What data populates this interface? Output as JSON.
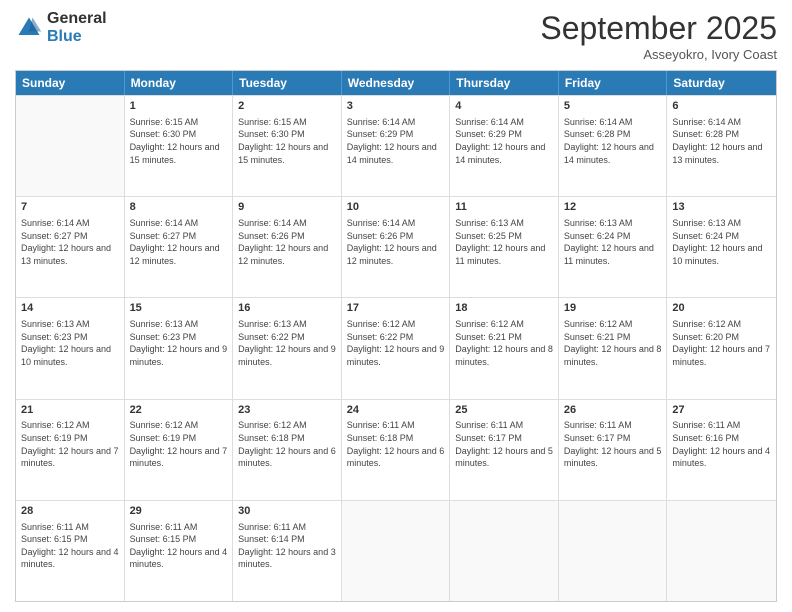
{
  "logo": {
    "general": "General",
    "blue": "Blue"
  },
  "header": {
    "month": "September 2025",
    "location": "Asseyokro, Ivory Coast"
  },
  "days": [
    "Sunday",
    "Monday",
    "Tuesday",
    "Wednesday",
    "Thursday",
    "Friday",
    "Saturday"
  ],
  "weeks": [
    [
      {
        "num": "",
        "sunrise": "",
        "sunset": "",
        "daylight": ""
      },
      {
        "num": "1",
        "sunrise": "Sunrise: 6:15 AM",
        "sunset": "Sunset: 6:30 PM",
        "daylight": "Daylight: 12 hours and 15 minutes."
      },
      {
        "num": "2",
        "sunrise": "Sunrise: 6:15 AM",
        "sunset": "Sunset: 6:30 PM",
        "daylight": "Daylight: 12 hours and 15 minutes."
      },
      {
        "num": "3",
        "sunrise": "Sunrise: 6:14 AM",
        "sunset": "Sunset: 6:29 PM",
        "daylight": "Daylight: 12 hours and 14 minutes."
      },
      {
        "num": "4",
        "sunrise": "Sunrise: 6:14 AM",
        "sunset": "Sunset: 6:29 PM",
        "daylight": "Daylight: 12 hours and 14 minutes."
      },
      {
        "num": "5",
        "sunrise": "Sunrise: 6:14 AM",
        "sunset": "Sunset: 6:28 PM",
        "daylight": "Daylight: 12 hours and 14 minutes."
      },
      {
        "num": "6",
        "sunrise": "Sunrise: 6:14 AM",
        "sunset": "Sunset: 6:28 PM",
        "daylight": "Daylight: 12 hours and 13 minutes."
      }
    ],
    [
      {
        "num": "7",
        "sunrise": "Sunrise: 6:14 AM",
        "sunset": "Sunset: 6:27 PM",
        "daylight": "Daylight: 12 hours and 13 minutes."
      },
      {
        "num": "8",
        "sunrise": "Sunrise: 6:14 AM",
        "sunset": "Sunset: 6:27 PM",
        "daylight": "Daylight: 12 hours and 12 minutes."
      },
      {
        "num": "9",
        "sunrise": "Sunrise: 6:14 AM",
        "sunset": "Sunset: 6:26 PM",
        "daylight": "Daylight: 12 hours and 12 minutes."
      },
      {
        "num": "10",
        "sunrise": "Sunrise: 6:14 AM",
        "sunset": "Sunset: 6:26 PM",
        "daylight": "Daylight: 12 hours and 12 minutes."
      },
      {
        "num": "11",
        "sunrise": "Sunrise: 6:13 AM",
        "sunset": "Sunset: 6:25 PM",
        "daylight": "Daylight: 12 hours and 11 minutes."
      },
      {
        "num": "12",
        "sunrise": "Sunrise: 6:13 AM",
        "sunset": "Sunset: 6:24 PM",
        "daylight": "Daylight: 12 hours and 11 minutes."
      },
      {
        "num": "13",
        "sunrise": "Sunrise: 6:13 AM",
        "sunset": "Sunset: 6:24 PM",
        "daylight": "Daylight: 12 hours and 10 minutes."
      }
    ],
    [
      {
        "num": "14",
        "sunrise": "Sunrise: 6:13 AM",
        "sunset": "Sunset: 6:23 PM",
        "daylight": "Daylight: 12 hours and 10 minutes."
      },
      {
        "num": "15",
        "sunrise": "Sunrise: 6:13 AM",
        "sunset": "Sunset: 6:23 PM",
        "daylight": "Daylight: 12 hours and 9 minutes."
      },
      {
        "num": "16",
        "sunrise": "Sunrise: 6:13 AM",
        "sunset": "Sunset: 6:22 PM",
        "daylight": "Daylight: 12 hours and 9 minutes."
      },
      {
        "num": "17",
        "sunrise": "Sunrise: 6:12 AM",
        "sunset": "Sunset: 6:22 PM",
        "daylight": "Daylight: 12 hours and 9 minutes."
      },
      {
        "num": "18",
        "sunrise": "Sunrise: 6:12 AM",
        "sunset": "Sunset: 6:21 PM",
        "daylight": "Daylight: 12 hours and 8 minutes."
      },
      {
        "num": "19",
        "sunrise": "Sunrise: 6:12 AM",
        "sunset": "Sunset: 6:21 PM",
        "daylight": "Daylight: 12 hours and 8 minutes."
      },
      {
        "num": "20",
        "sunrise": "Sunrise: 6:12 AM",
        "sunset": "Sunset: 6:20 PM",
        "daylight": "Daylight: 12 hours and 7 minutes."
      }
    ],
    [
      {
        "num": "21",
        "sunrise": "Sunrise: 6:12 AM",
        "sunset": "Sunset: 6:19 PM",
        "daylight": "Daylight: 12 hours and 7 minutes."
      },
      {
        "num": "22",
        "sunrise": "Sunrise: 6:12 AM",
        "sunset": "Sunset: 6:19 PM",
        "daylight": "Daylight: 12 hours and 7 minutes."
      },
      {
        "num": "23",
        "sunrise": "Sunrise: 6:12 AM",
        "sunset": "Sunset: 6:18 PM",
        "daylight": "Daylight: 12 hours and 6 minutes."
      },
      {
        "num": "24",
        "sunrise": "Sunrise: 6:11 AM",
        "sunset": "Sunset: 6:18 PM",
        "daylight": "Daylight: 12 hours and 6 minutes."
      },
      {
        "num": "25",
        "sunrise": "Sunrise: 6:11 AM",
        "sunset": "Sunset: 6:17 PM",
        "daylight": "Daylight: 12 hours and 5 minutes."
      },
      {
        "num": "26",
        "sunrise": "Sunrise: 6:11 AM",
        "sunset": "Sunset: 6:17 PM",
        "daylight": "Daylight: 12 hours and 5 minutes."
      },
      {
        "num": "27",
        "sunrise": "Sunrise: 6:11 AM",
        "sunset": "Sunset: 6:16 PM",
        "daylight": "Daylight: 12 hours and 4 minutes."
      }
    ],
    [
      {
        "num": "28",
        "sunrise": "Sunrise: 6:11 AM",
        "sunset": "Sunset: 6:15 PM",
        "daylight": "Daylight: 12 hours and 4 minutes."
      },
      {
        "num": "29",
        "sunrise": "Sunrise: 6:11 AM",
        "sunset": "Sunset: 6:15 PM",
        "daylight": "Daylight: 12 hours and 4 minutes."
      },
      {
        "num": "30",
        "sunrise": "Sunrise: 6:11 AM",
        "sunset": "Sunset: 6:14 PM",
        "daylight": "Daylight: 12 hours and 3 minutes."
      },
      {
        "num": "",
        "sunrise": "",
        "sunset": "",
        "daylight": ""
      },
      {
        "num": "",
        "sunrise": "",
        "sunset": "",
        "daylight": ""
      },
      {
        "num": "",
        "sunrise": "",
        "sunset": "",
        "daylight": ""
      },
      {
        "num": "",
        "sunrise": "",
        "sunset": "",
        "daylight": ""
      }
    ]
  ]
}
